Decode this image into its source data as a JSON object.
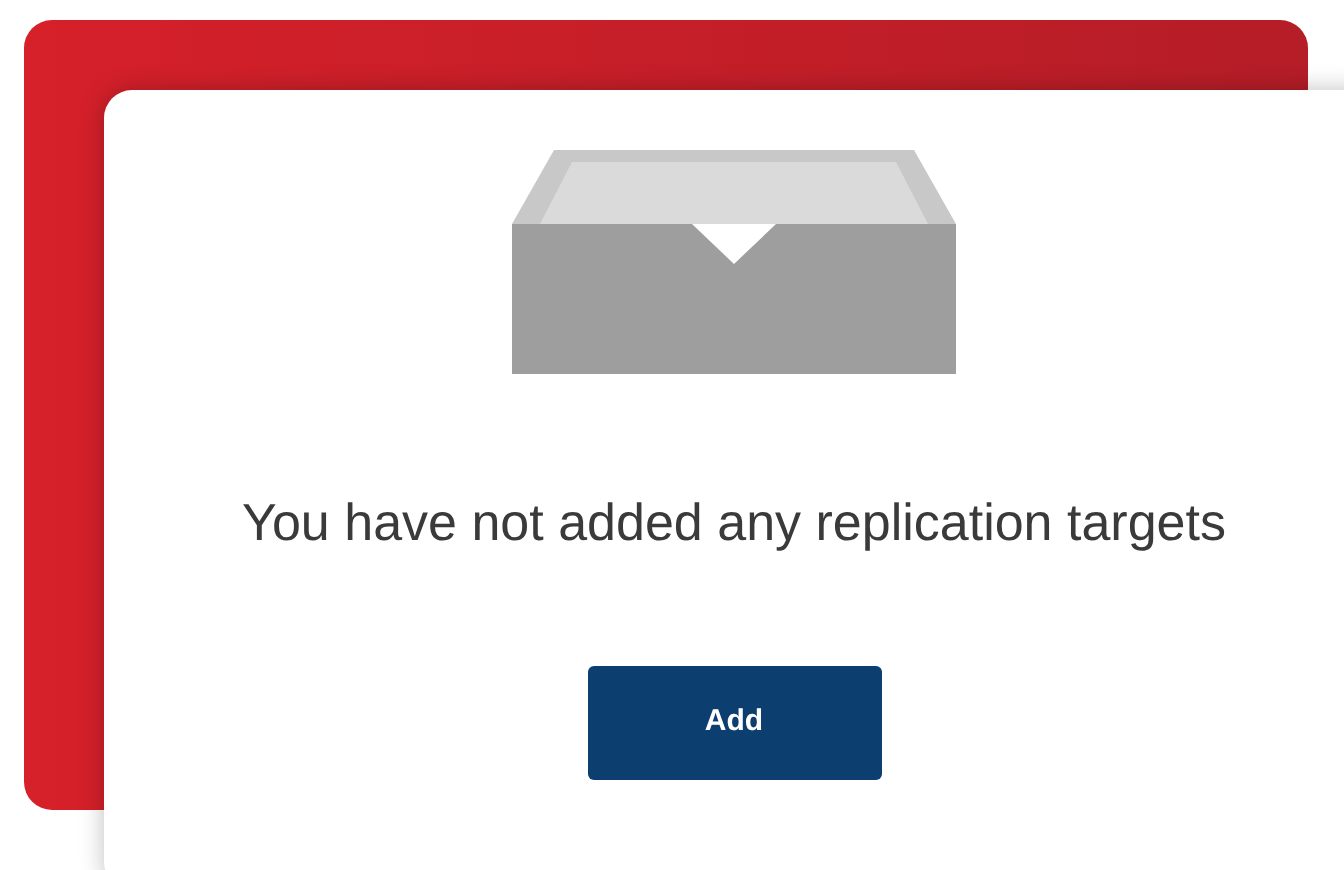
{
  "empty_state": {
    "message": "You have not added any replication targets",
    "button": "Add"
  }
}
